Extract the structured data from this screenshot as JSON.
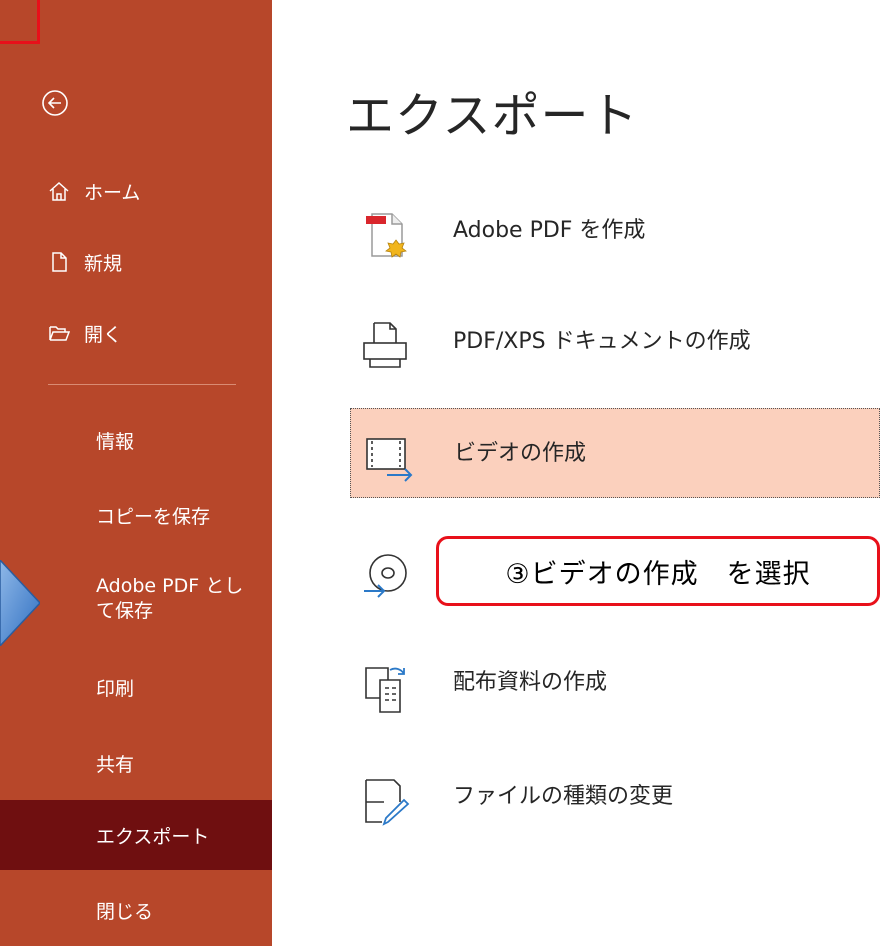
{
  "app": {
    "accent": "#b7472a",
    "active": "#6f0f10",
    "selected_bg": "#fbd0bd",
    "annotation_color": "#e8101a"
  },
  "sidebar": {
    "back_icon": "back-arrow-circle-icon",
    "items": [
      {
        "label": "ホーム",
        "icon": "home-icon"
      },
      {
        "label": "新規",
        "icon": "new-document-icon"
      },
      {
        "label": "開く",
        "icon": "folder-open-icon"
      },
      {
        "label": "情報"
      },
      {
        "label": "コピーを保存"
      },
      {
        "label": "Adobe PDF として保存"
      },
      {
        "label": "印刷"
      },
      {
        "label": "共有"
      },
      {
        "label": "エクスポート",
        "active": true
      },
      {
        "label": "閉じる"
      }
    ]
  },
  "main": {
    "title": "エクスポート",
    "options": [
      {
        "label": "Adobe PDF を作成",
        "icon": "adobe-pdf-icon"
      },
      {
        "label": "PDF/XPS ドキュメントの作成",
        "icon": "pdf-xps-icon"
      },
      {
        "label": "ビデオの作成",
        "icon": "video-icon",
        "selected": true
      },
      {
        "label": "",
        "icon": "cd-icon"
      },
      {
        "label": "配布資料の作成",
        "icon": "handout-icon"
      },
      {
        "label": "ファイルの種類の変更",
        "icon": "change-file-type-icon"
      }
    ]
  },
  "annotation": {
    "text": "③ビデオの作成　を選択"
  }
}
